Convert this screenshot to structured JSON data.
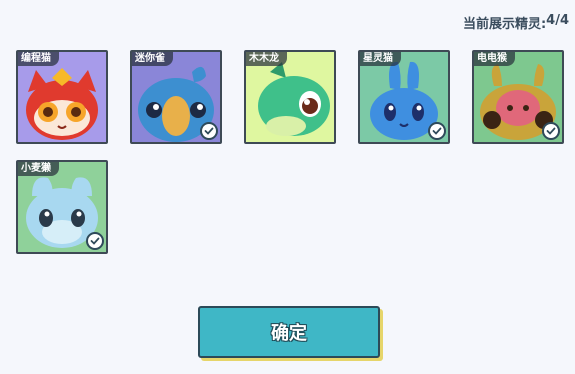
{
  "header": {
    "counter_label": "当前展示精灵:",
    "counter_value": "4/4"
  },
  "sprites": [
    {
      "name": "编程猫",
      "selected": false,
      "bg": "#a79bea"
    },
    {
      "name": "迷你雀",
      "selected": true,
      "bg": "#8a86d8"
    },
    {
      "name": "木木龙",
      "selected": false,
      "bg": "#dff7a0"
    },
    {
      "name": "星灵猫",
      "selected": true,
      "bg": "#7cc9a6"
    },
    {
      "name": "电电猴",
      "selected": true,
      "bg": "#7ec88f"
    },
    {
      "name": "小麦獭",
      "selected": true,
      "bg": "#8fd19a"
    }
  ],
  "footer": {
    "confirm_label": "确定"
  },
  "colors": {
    "accent": "#3fb7c6",
    "border": "#3e4a55",
    "check": "#2f4a5a"
  }
}
